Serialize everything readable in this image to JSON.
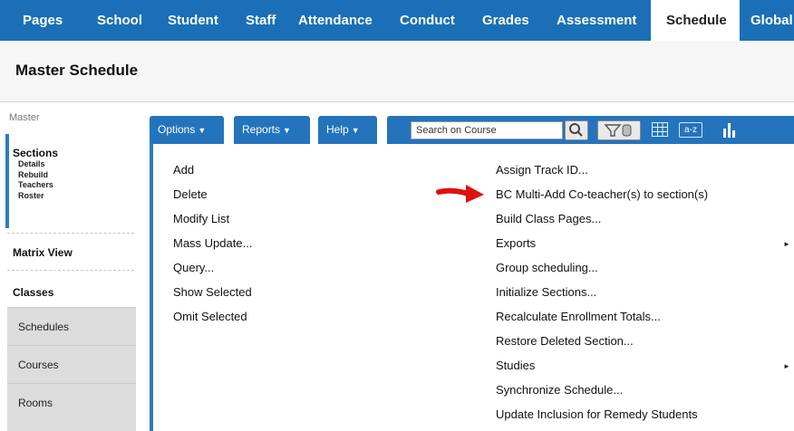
{
  "topnav": {
    "tabs": [
      {
        "label": "Pages"
      },
      {
        "label": "School"
      },
      {
        "label": "Student"
      },
      {
        "label": "Staff"
      },
      {
        "label": "Attendance"
      },
      {
        "label": "Conduct"
      },
      {
        "label": "Grades"
      },
      {
        "label": "Assessment"
      },
      {
        "label": "Schedule",
        "active": true
      },
      {
        "label": "Global"
      }
    ],
    "accent_color": "#1a6fb7"
  },
  "header": {
    "title": "Master Schedule"
  },
  "sidebar": {
    "section_label": "Master",
    "sections": {
      "title": "Sections",
      "subitems": [
        "Details",
        "Rebuild",
        "Teachers",
        "Roster"
      ]
    },
    "matrix_view": "Matrix View",
    "classes": "Classes",
    "gray_items": [
      "Schedules",
      "Courses",
      "Rooms"
    ]
  },
  "toolbar": {
    "options_label": "Options",
    "reports_label": "Reports",
    "help_label": "Help",
    "search_placeholder": "Search on Course",
    "az_label": "a-z"
  },
  "options_menu": {
    "left_column": [
      "Add",
      "Delete",
      "Modify List",
      "Mass Update...",
      "Query...",
      "Show Selected",
      "Omit Selected"
    ],
    "right_column": [
      {
        "label": "Assign Track ID..."
      },
      {
        "label": "BC Multi-Add Co-teacher(s) to section(s)"
      },
      {
        "label": "Build Class Pages..."
      },
      {
        "label": "Exports",
        "has_submenu": true
      },
      {
        "label": "Group scheduling..."
      },
      {
        "label": "Initialize Sections..."
      },
      {
        "label": "Recalculate Enrollment Totals..."
      },
      {
        "label": "Restore Deleted Section..."
      },
      {
        "label": "Studies",
        "has_submenu": true
      },
      {
        "label": "Synchronize Schedule..."
      },
      {
        "label": "Update Inclusion for Remedy Students"
      }
    ]
  },
  "annotation": {
    "arrow_color": "#e01010"
  }
}
